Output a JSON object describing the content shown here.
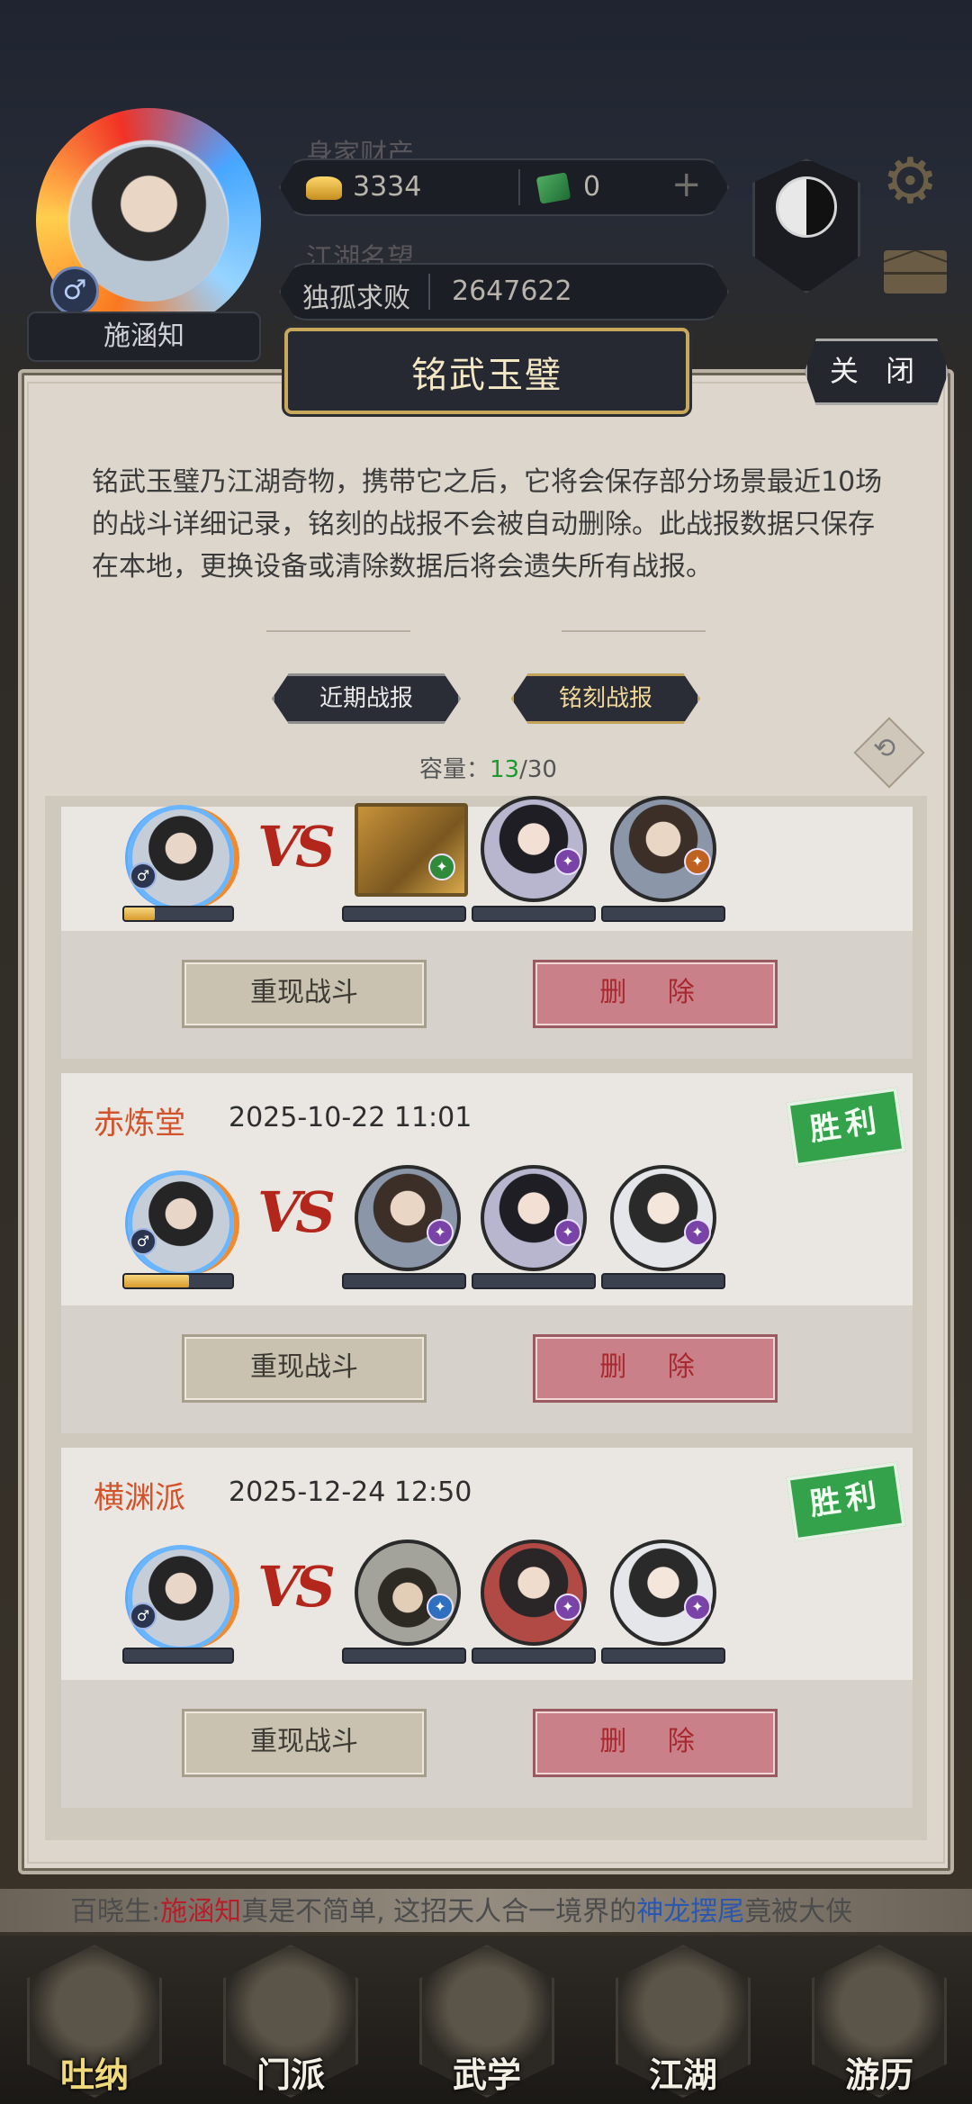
{
  "header": {
    "player_name": "施涵知",
    "gender_symbol": "♂",
    "wealth_label": "身家财产",
    "gold": "3334",
    "jade": "0",
    "plus": "+",
    "fame_label": "江湖名望",
    "fame_title": "独孤求败",
    "fame_value": "2647622"
  },
  "modal": {
    "title": "铭武玉璧",
    "close": "关 闭",
    "description": "铭武玉璧乃江湖奇物，携带它之后，它将会保存部分场景最近10场的战斗详细记录，铭刻的战报不会被自动删除。此战报数据只保存在本地，更换设备或清除数据后将会遗失所有战报。",
    "tabs": [
      "近期战报",
      "铭刻战报"
    ],
    "capacity_label": "容量：",
    "capacity_current": "13",
    "capacity_total": "/30",
    "vs": "VS",
    "replay_label": "重现战斗",
    "delete_label": "删 除",
    "records": [
      {
        "sect": "",
        "time": "",
        "result": ""
      },
      {
        "sect": "赤炼堂",
        "time": "2025-10-22 11:01",
        "result": "胜利"
      },
      {
        "sect": "横渊派",
        "time": "2025-12-24 12:50",
        "result": "胜利"
      }
    ]
  },
  "chat": {
    "speaker": "百晓生:",
    "name": "施涵知",
    "text1": "真是不简单, 这招天人合一境界的",
    "skill": "神龙摆尾",
    "text2": "竟被大侠"
  },
  "nav": [
    "吐纳",
    "门派",
    "武学",
    "江湖",
    "游历"
  ]
}
